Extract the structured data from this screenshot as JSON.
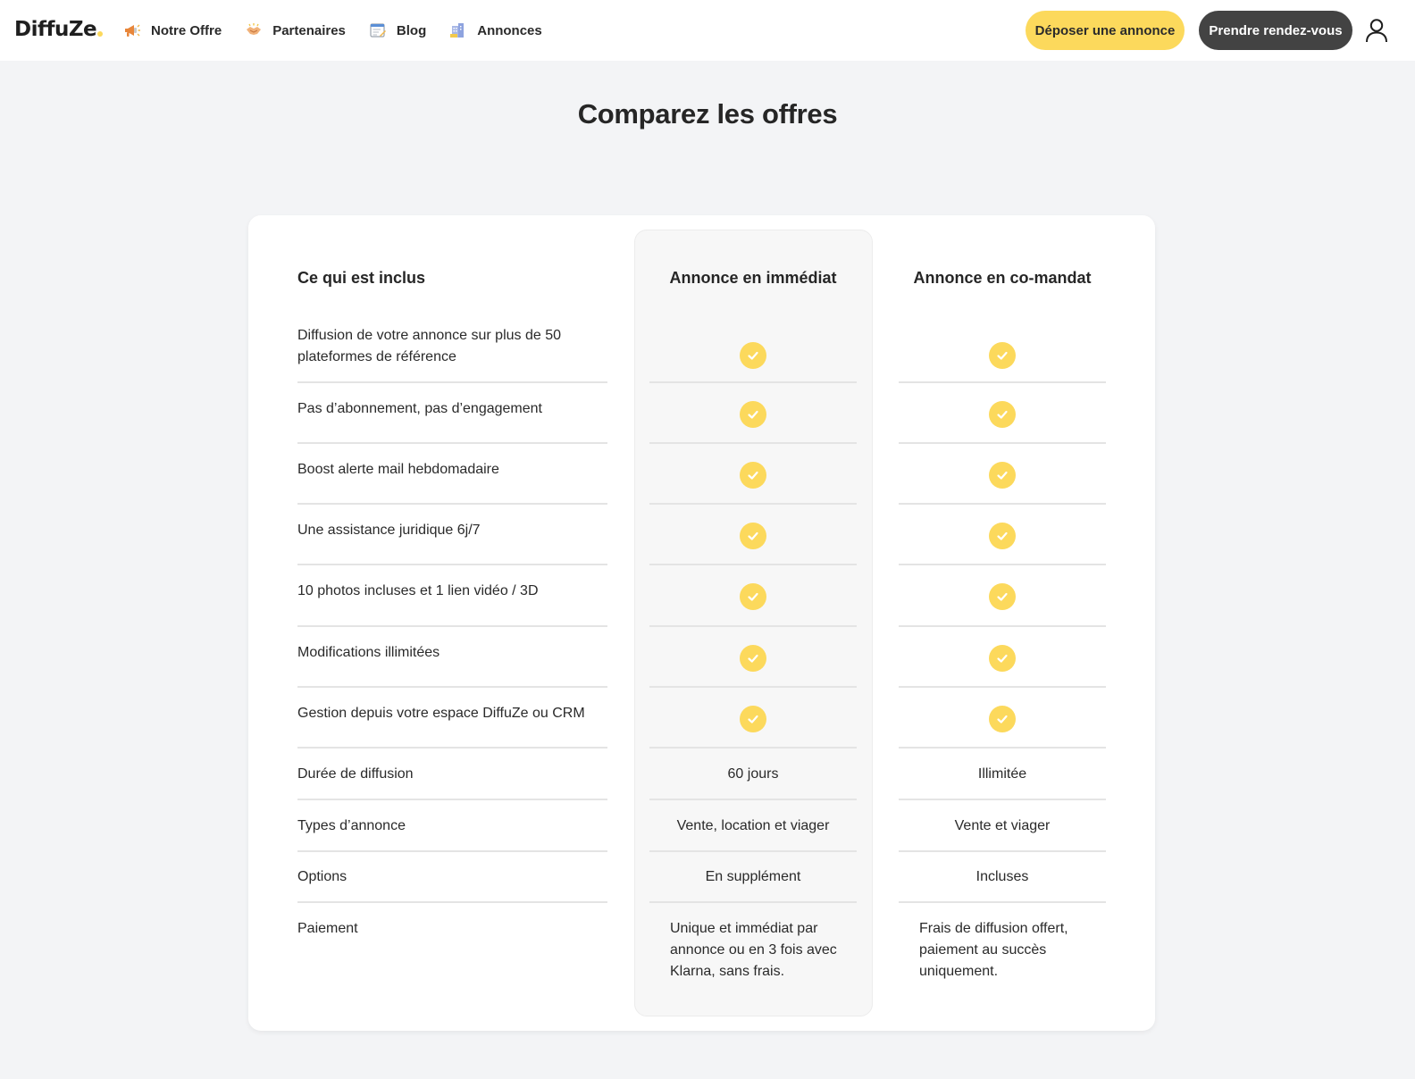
{
  "brand": {
    "name": "DiffuZe",
    "dot_color": "#fcd95c"
  },
  "colors": {
    "accent": "#fcd95c",
    "dark": "#434343",
    "check_mark": "#ffffff"
  },
  "nav": [
    {
      "label": "Notre Offre",
      "icon": "megaphone-icon"
    },
    {
      "label": "Partenaires",
      "icon": "handshake-icon"
    },
    {
      "label": "Blog",
      "icon": "notepad-icon"
    },
    {
      "label": "Annonces",
      "icon": "buildings-icon"
    }
  ],
  "header": {
    "deposit_label": "Déposer une annonce",
    "rdv_label": "Prendre rendez-vous",
    "user_icon": "user-icon"
  },
  "title": "Comparez les offres",
  "table": {
    "headers": {
      "feature": "Ce qui est inclus",
      "col1": "Annonce en immédiat",
      "col2": "Annonce en co-mandat"
    },
    "rows": [
      {
        "label": "Diffusion de votre annonce sur plus de 50 plateformes de référence",
        "col1": "check",
        "col2": "check"
      },
      {
        "label": "Pas d’abonnement, pas d’engagement",
        "col1": "check",
        "col2": "check"
      },
      {
        "label": "Boost alerte mail hebdomadaire",
        "col1": "check",
        "col2": "check"
      },
      {
        "label": "Une assistance juridique 6j/7",
        "col1": "check",
        "col2": "check"
      },
      {
        "label": "10 photos incluses et 1 lien vidéo / 3D",
        "col1": "check",
        "col2": "check"
      },
      {
        "label": "Modifications illimitées",
        "col1": "check",
        "col2": "check"
      },
      {
        "label": "Gestion depuis votre espace DiffuZe ou CRM",
        "col1": "check",
        "col2": "check"
      },
      {
        "label": "Durée de diffusion",
        "col1": "60 jours",
        "col2": "Illimitée"
      },
      {
        "label": "Types d’annonce",
        "col1": "Vente, location et viager",
        "col2": "Vente et viager"
      },
      {
        "label": "Options",
        "col1": "En supplément",
        "col2": "Incluses"
      },
      {
        "label": "Paiement",
        "col1": "Unique et immédiat par annonce ou en 3 fois avec Klarna, sans frais.",
        "col2": "Frais de diffusion offert, paiement au succès uniquement."
      }
    ]
  }
}
